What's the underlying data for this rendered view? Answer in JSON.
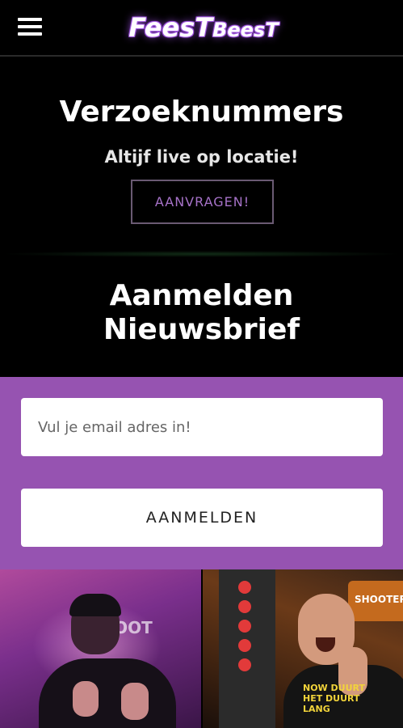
{
  "header": {
    "menu_icon": "hamburger-menu-icon",
    "logo_text_big": "FeesT",
    "logo_text_small": "BeesT"
  },
  "requests": {
    "title": "Verzoeknummers",
    "subtitle": "Altijf live op locatie!",
    "button_label": "AANVRAGEN!"
  },
  "newsletter": {
    "title_line1": "Aanmelden",
    "title_line2": "Nieuwsbrief",
    "email_placeholder": "Vul je email adres in!",
    "submit_label": "AANMELDEN",
    "accent_color": "#9653b1"
  },
  "photos": {
    "left_sign_text": "SHOOT",
    "right_sign_text": "SHOOTER",
    "right_shirt_text": "NOW DUURT\nHET DUURT\nLANG"
  }
}
